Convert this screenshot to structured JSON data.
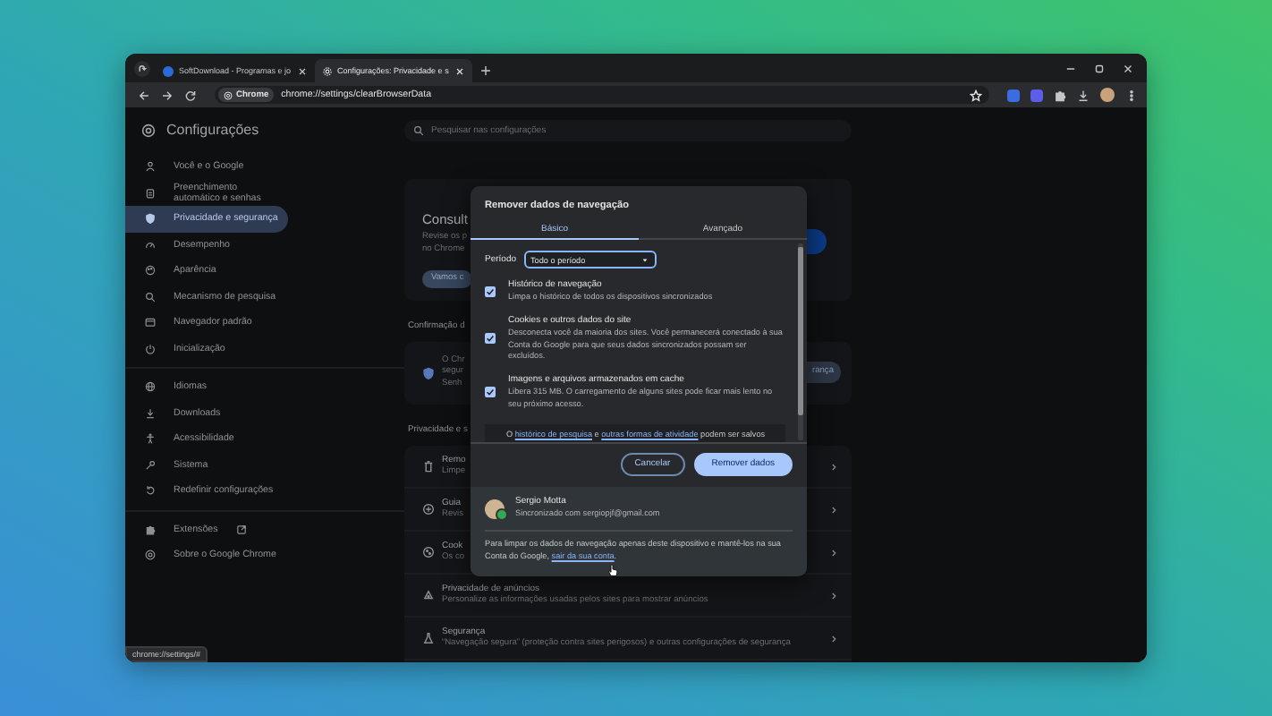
{
  "browser": {
    "tabs": [
      {
        "title": "SoftDownload - Programas e jo",
        "selected": false
      },
      {
        "title": "Configurações: Privacidade e s",
        "selected": true
      }
    ],
    "address_bar": {
      "chip": "Chrome",
      "url": "chrome://settings/clearBrowserData"
    }
  },
  "settings": {
    "title": "Configurações",
    "search": {
      "placeholder": "Pesquisar nas configurações"
    },
    "sidebar": {
      "groups": [
        {
          "items": [
            {
              "label": "Você e o Google",
              "selected": false,
              "kind": "page"
            },
            {
              "label": "Preenchimento automático e senhas",
              "selected": false,
              "kind": "page"
            },
            {
              "label": "Privacidade e segurança",
              "selected": true,
              "kind": "page"
            },
            {
              "label": "Desempenho",
              "selected": false,
              "kind": "page"
            },
            {
              "label": "Aparência",
              "selected": false,
              "kind": "page"
            },
            {
              "label": "Mecanismo de pesquisa",
              "selected": false,
              "kind": "page"
            },
            {
              "label": "Navegador padrão",
              "selected": false,
              "kind": "page"
            },
            {
              "label": "Inicialização",
              "selected": false,
              "kind": "page"
            }
          ]
        },
        {
          "items": [
            {
              "label": "Idiomas",
              "selected": false,
              "kind": "page"
            },
            {
              "label": "Downloads",
              "selected": false,
              "kind": "page"
            },
            {
              "label": "Acessibilidade",
              "selected": false,
              "kind": "page"
            },
            {
              "label": "Sistema",
              "selected": false,
              "kind": "page"
            },
            {
              "label": "Redefinir configurações",
              "selected": false,
              "kind": "page"
            }
          ]
        },
        {
          "items": [
            {
              "label": "Extensões",
              "selected": false,
              "kind": "external"
            },
            {
              "label": "Sobre o Google Chrome",
              "selected": false,
              "kind": "page"
            }
          ]
        }
      ]
    },
    "main": {
      "safety_card": {
        "title": "Consult",
        "lines": [
          "Revise os p",
          "no Chrome"
        ],
        "button": "Vamos c"
      },
      "confirmation": {
        "heading": "Confirmação d",
        "lines": [
          "O Chr",
          "segur",
          "Senh"
        ],
        "button": "rança"
      },
      "privacy": {
        "heading": "Privacidade e s",
        "rows": [
          {
            "title": "Remo",
            "description": "Limpe"
          },
          {
            "title": "Guia",
            "description": "Revis"
          },
          {
            "title": "Cook",
            "description": "Os co"
          },
          {
            "title": "Privacidade de anúncios",
            "description": "Personalize as informações usadas pelos sites para mostrar anúncios"
          },
          {
            "title": "Segurança",
            "description": "“Navegação segura” (proteção contra sites perigosos) e outras configurações de segurança"
          }
        ]
      }
    }
  },
  "dialog": {
    "title": "Remover dados de navegação",
    "tabs": [
      {
        "label": "Básico",
        "selected": true
      },
      {
        "label": "Avançado",
        "selected": false
      }
    ],
    "period": {
      "label": "Período",
      "value": "Todo o período"
    },
    "options": [
      {
        "title": "Histórico de navegação",
        "description": "Limpa o histórico de todos os dispositivos sincronizados",
        "checked": true
      },
      {
        "title": "Cookies e outros dados do site",
        "description": "Desconecta você da maioria dos sites. Você permanecerá conectado à sua Conta do Google para que seus dados sincronizados possam ser excluídos.",
        "checked": true
      },
      {
        "title": "Imagens e arquivos armazenados em cache",
        "description": "Libera 315 MB. O carregamento de alguns sites pode ficar mais lento no seu próximo acesso.",
        "checked": true
      }
    ],
    "notice": [
      {
        "text": "O ",
        "link": false
      },
      {
        "text": "histórico de pesquisa",
        "link": true
      },
      {
        "text": " e ",
        "link": false
      },
      {
        "text": "outras formas de atividade",
        "link": true
      },
      {
        "text": " podem ser salvos",
        "link": false
      }
    ],
    "buttons": [
      {
        "label": "Cancelar",
        "kind": "secondary"
      },
      {
        "label": "Remover dados",
        "kind": "primary"
      }
    ],
    "account": {
      "name": "Sergio Motta",
      "status": "Sincronizado com sergiopjf@gmail.com"
    },
    "sign_out_note": {
      "text": "Para limpar os dados de navegação apenas deste dispositivo e mantê-los na sua Conta do Google, ",
      "link": "sair da sua conta",
      "suffix": "."
    }
  },
  "status_bar": "chrome://settings/#"
}
